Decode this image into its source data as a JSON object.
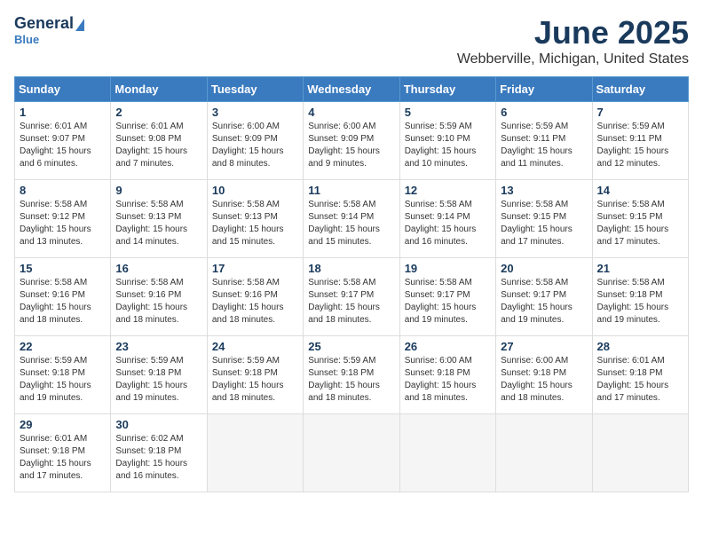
{
  "header": {
    "logo_general": "General",
    "logo_blue": "Blue",
    "month_title": "June 2025",
    "location": "Webberville, Michigan, United States"
  },
  "weekdays": [
    "Sunday",
    "Monday",
    "Tuesday",
    "Wednesday",
    "Thursday",
    "Friday",
    "Saturday"
  ],
  "weeks": [
    [
      {
        "day": "1",
        "sunrise": "6:01 AM",
        "sunset": "9:07 PM",
        "daylight": "15 hours and 6 minutes."
      },
      {
        "day": "2",
        "sunrise": "6:01 AM",
        "sunset": "9:08 PM",
        "daylight": "15 hours and 7 minutes."
      },
      {
        "day": "3",
        "sunrise": "6:00 AM",
        "sunset": "9:09 PM",
        "daylight": "15 hours and 8 minutes."
      },
      {
        "day": "4",
        "sunrise": "6:00 AM",
        "sunset": "9:09 PM",
        "daylight": "15 hours and 9 minutes."
      },
      {
        "day": "5",
        "sunrise": "5:59 AM",
        "sunset": "9:10 PM",
        "daylight": "15 hours and 10 minutes."
      },
      {
        "day": "6",
        "sunrise": "5:59 AM",
        "sunset": "9:11 PM",
        "daylight": "15 hours and 11 minutes."
      },
      {
        "day": "7",
        "sunrise": "5:59 AM",
        "sunset": "9:11 PM",
        "daylight": "15 hours and 12 minutes."
      }
    ],
    [
      {
        "day": "8",
        "sunrise": "5:58 AM",
        "sunset": "9:12 PM",
        "daylight": "15 hours and 13 minutes."
      },
      {
        "day": "9",
        "sunrise": "5:58 AM",
        "sunset": "9:13 PM",
        "daylight": "15 hours and 14 minutes."
      },
      {
        "day": "10",
        "sunrise": "5:58 AM",
        "sunset": "9:13 PM",
        "daylight": "15 hours and 15 minutes."
      },
      {
        "day": "11",
        "sunrise": "5:58 AM",
        "sunset": "9:14 PM",
        "daylight": "15 hours and 15 minutes."
      },
      {
        "day": "12",
        "sunrise": "5:58 AM",
        "sunset": "9:14 PM",
        "daylight": "15 hours and 16 minutes."
      },
      {
        "day": "13",
        "sunrise": "5:58 AM",
        "sunset": "9:15 PM",
        "daylight": "15 hours and 17 minutes."
      },
      {
        "day": "14",
        "sunrise": "5:58 AM",
        "sunset": "9:15 PM",
        "daylight": "15 hours and 17 minutes."
      }
    ],
    [
      {
        "day": "15",
        "sunrise": "5:58 AM",
        "sunset": "9:16 PM",
        "daylight": "15 hours and 18 minutes."
      },
      {
        "day": "16",
        "sunrise": "5:58 AM",
        "sunset": "9:16 PM",
        "daylight": "15 hours and 18 minutes."
      },
      {
        "day": "17",
        "sunrise": "5:58 AM",
        "sunset": "9:16 PM",
        "daylight": "15 hours and 18 minutes."
      },
      {
        "day": "18",
        "sunrise": "5:58 AM",
        "sunset": "9:17 PM",
        "daylight": "15 hours and 18 minutes."
      },
      {
        "day": "19",
        "sunrise": "5:58 AM",
        "sunset": "9:17 PM",
        "daylight": "15 hours and 19 minutes."
      },
      {
        "day": "20",
        "sunrise": "5:58 AM",
        "sunset": "9:17 PM",
        "daylight": "15 hours and 19 minutes."
      },
      {
        "day": "21",
        "sunrise": "5:58 AM",
        "sunset": "9:18 PM",
        "daylight": "15 hours and 19 minutes."
      }
    ],
    [
      {
        "day": "22",
        "sunrise": "5:59 AM",
        "sunset": "9:18 PM",
        "daylight": "15 hours and 19 minutes."
      },
      {
        "day": "23",
        "sunrise": "5:59 AM",
        "sunset": "9:18 PM",
        "daylight": "15 hours and 19 minutes."
      },
      {
        "day": "24",
        "sunrise": "5:59 AM",
        "sunset": "9:18 PM",
        "daylight": "15 hours and 18 minutes."
      },
      {
        "day": "25",
        "sunrise": "5:59 AM",
        "sunset": "9:18 PM",
        "daylight": "15 hours and 18 minutes."
      },
      {
        "day": "26",
        "sunrise": "6:00 AM",
        "sunset": "9:18 PM",
        "daylight": "15 hours and 18 minutes."
      },
      {
        "day": "27",
        "sunrise": "6:00 AM",
        "sunset": "9:18 PM",
        "daylight": "15 hours and 18 minutes."
      },
      {
        "day": "28",
        "sunrise": "6:01 AM",
        "sunset": "9:18 PM",
        "daylight": "15 hours and 17 minutes."
      }
    ],
    [
      {
        "day": "29",
        "sunrise": "6:01 AM",
        "sunset": "9:18 PM",
        "daylight": "15 hours and 17 minutes."
      },
      {
        "day": "30",
        "sunrise": "6:02 AM",
        "sunset": "9:18 PM",
        "daylight": "15 hours and 16 minutes."
      },
      null,
      null,
      null,
      null,
      null
    ]
  ]
}
